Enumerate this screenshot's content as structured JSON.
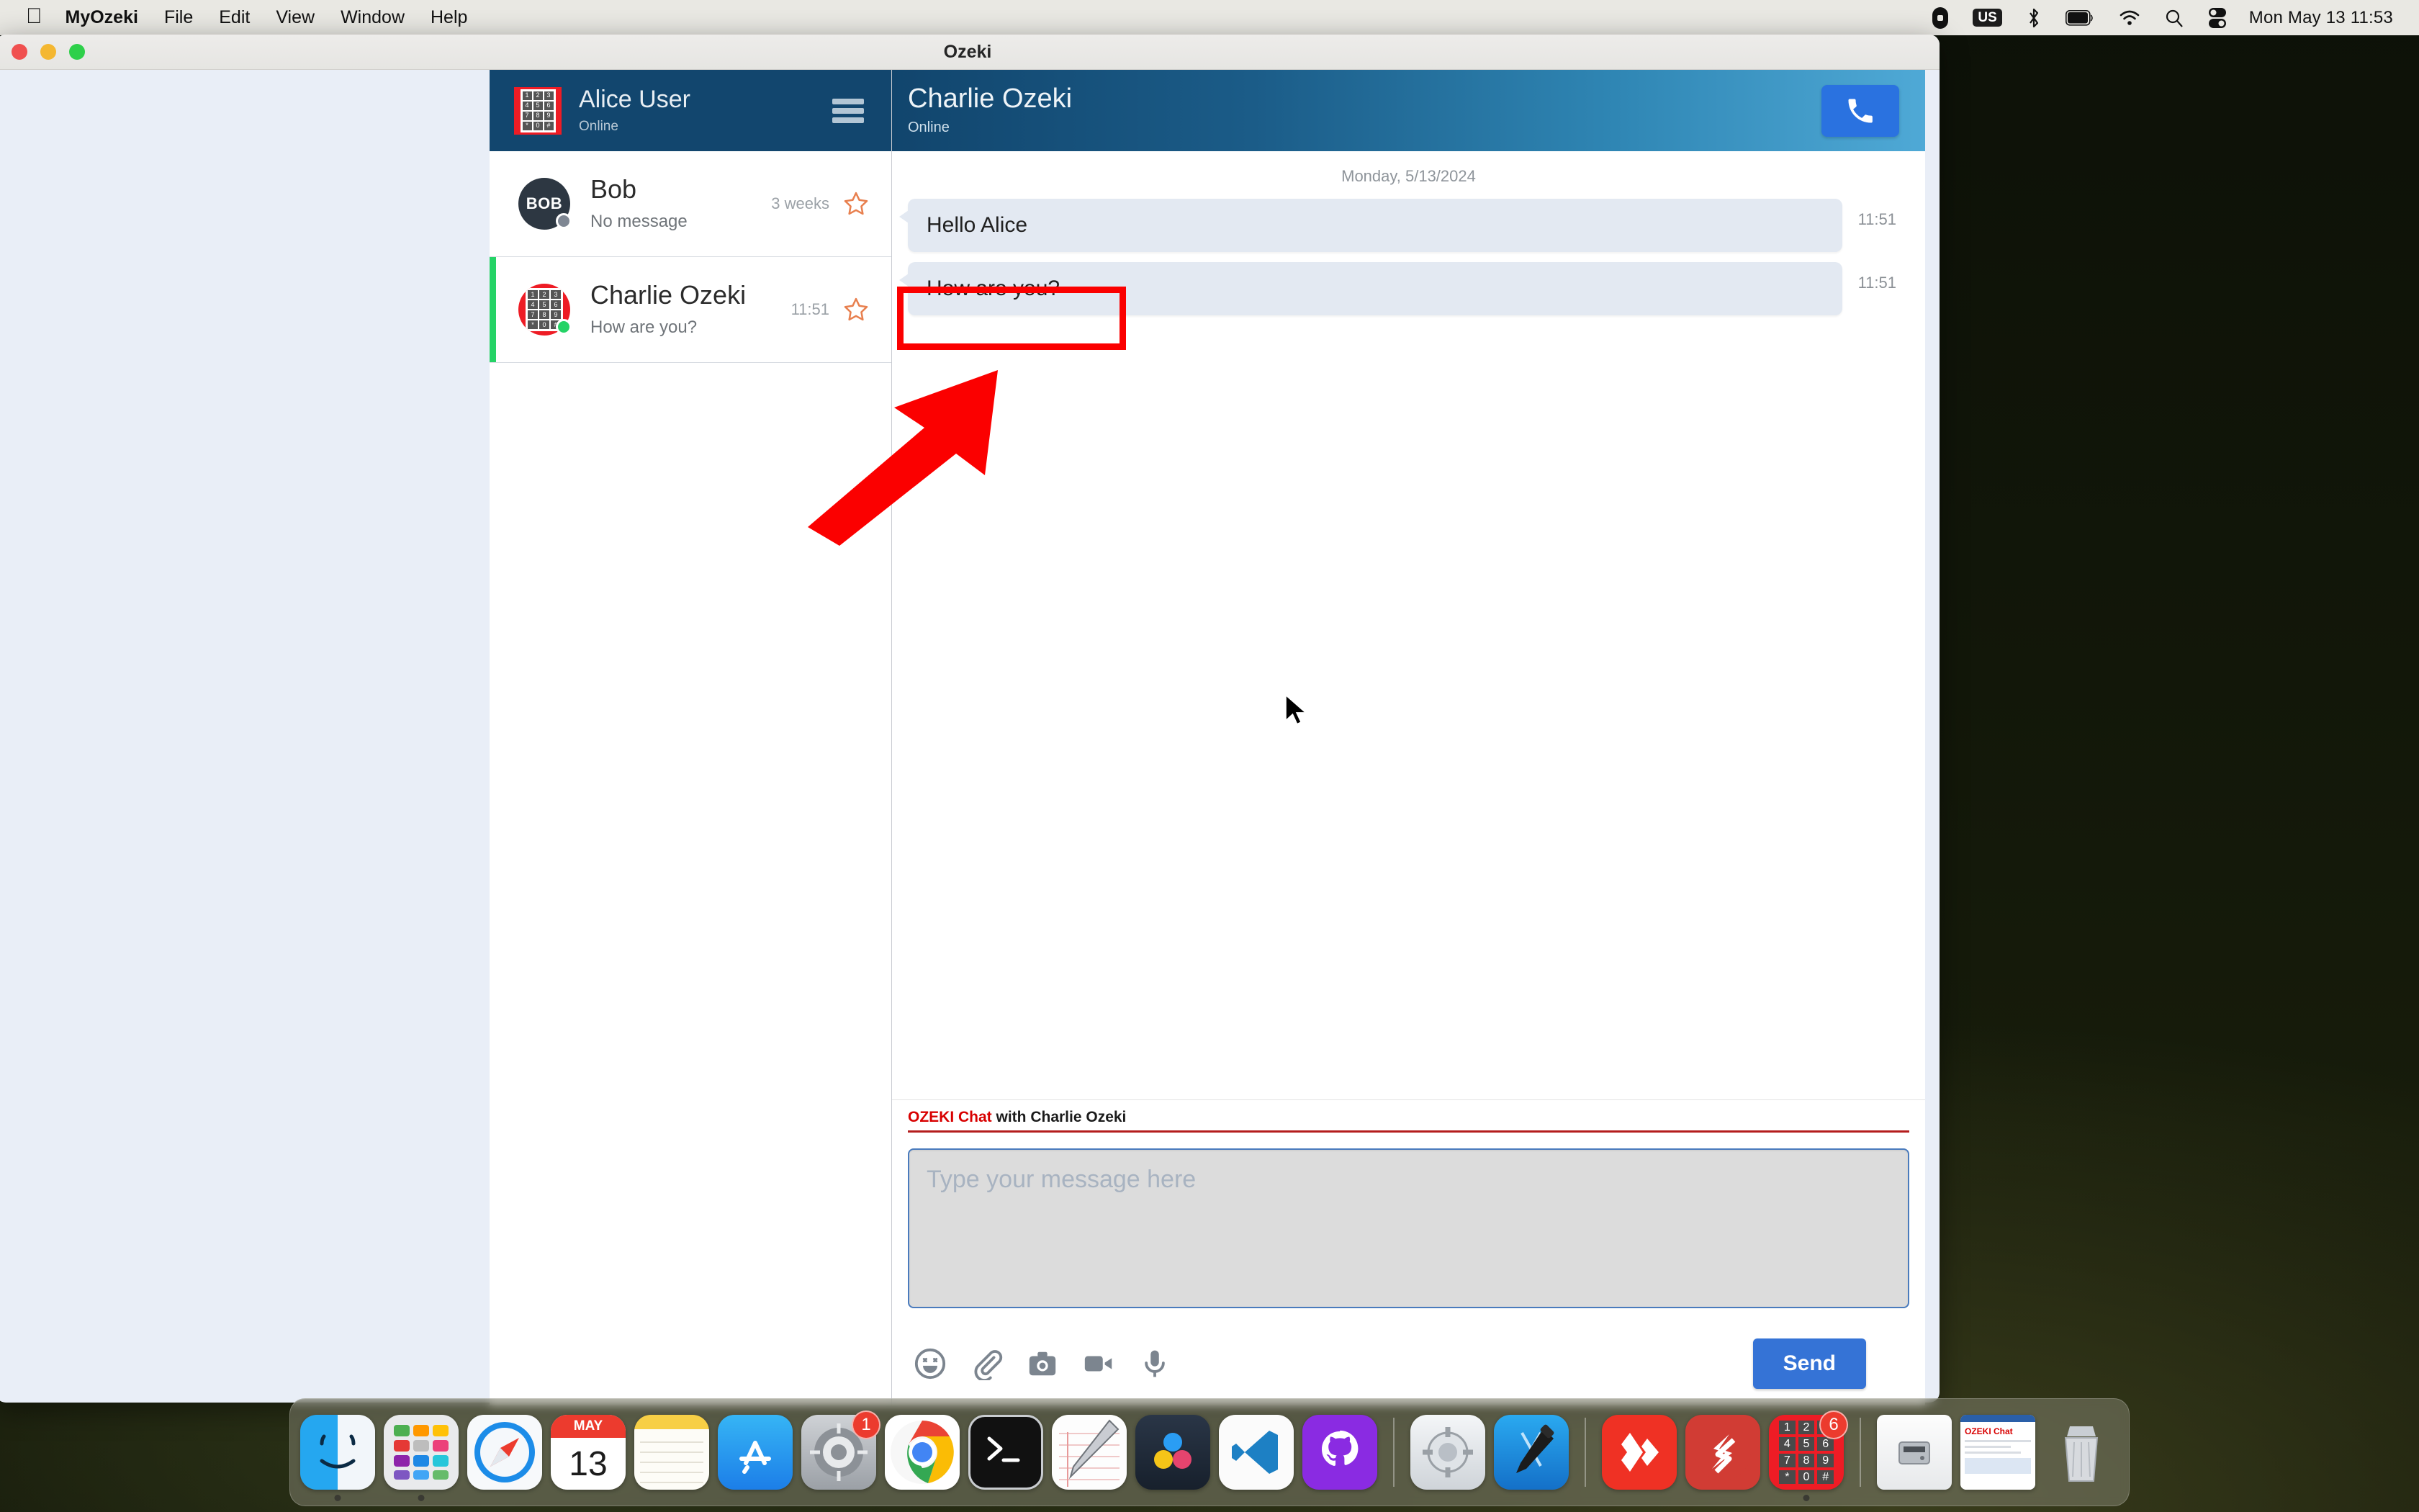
{
  "menubar": {
    "apple_icon": "apple-logo",
    "items": [
      "MyOzeki",
      "File",
      "Edit",
      "View",
      "Window",
      "Help"
    ],
    "right_icons": [
      "control-center-pill-icon",
      "keyboard-layout-icon",
      "bluetooth-icon",
      "battery-icon",
      "wifi-icon",
      "search-icon",
      "control-center-icon"
    ],
    "keyboard_layout": "US",
    "clock": "Mon May 13  11:53"
  },
  "window": {
    "title": "Ozeki",
    "traffic_lights": [
      "close-button",
      "minimize-button",
      "maximize-button"
    ]
  },
  "sidebar": {
    "user": {
      "name": "Alice User",
      "status": "Online",
      "avatar": "ozeki-keypad-logo"
    },
    "menu_icon": "hamburger-menu-icon",
    "contacts": [
      {
        "name": "Bob",
        "preview": "No message",
        "time": "3 weeks",
        "avatar_text": "BOB",
        "presence": "offline",
        "selected": false,
        "starred": false
      },
      {
        "name": "Charlie Ozeki",
        "preview": "How are you?",
        "time": "11:51",
        "avatar_text": "",
        "presence": "online",
        "selected": true,
        "starred": false
      }
    ]
  },
  "chat": {
    "contact_name": "Charlie Ozeki",
    "contact_status": "Online",
    "call_button_icon": "phone-icon",
    "date_separator": "Monday, 5/13/2024",
    "messages": [
      {
        "text": "Hello Alice",
        "time": "11:51",
        "highlighted": false
      },
      {
        "text": "How are you?",
        "time": "11:51",
        "highlighted": true
      }
    ]
  },
  "composer": {
    "label_brand": "OZEKI Chat",
    "label_rest": " with Charlie Ozeki",
    "placeholder": "Type your message here",
    "input_value": "",
    "tools": [
      "emoji-icon",
      "attachment-icon",
      "camera-icon",
      "video-icon",
      "microphone-icon"
    ],
    "send_label": "Send"
  },
  "annotations": {
    "highlight_target": "How are you?",
    "arrow": "red-arrow-pointing-up-right",
    "box_color": "#fb0000"
  },
  "dock": {
    "items": [
      {
        "name": "finder",
        "label": "Finder",
        "running": true
      },
      {
        "name": "launchpad",
        "label": "Launchpad",
        "running": true
      },
      {
        "name": "safari",
        "label": "Safari",
        "running": false
      },
      {
        "name": "calendar",
        "label": "Calendar",
        "month": "MAY",
        "day": "13",
        "running": false
      },
      {
        "name": "notes",
        "label": "Notes",
        "running": false
      },
      {
        "name": "app-store",
        "label": "App Store",
        "running": false
      },
      {
        "name": "system-preferences",
        "label": "System Preferences",
        "badge": "1",
        "running": false
      },
      {
        "name": "chrome",
        "label": "Google Chrome",
        "running": false
      },
      {
        "name": "terminal",
        "label": "Terminal",
        "running": false
      },
      {
        "name": "textedit",
        "label": "TextEdit",
        "running": false
      },
      {
        "name": "davinci-resolve",
        "label": "DaVinci Resolve",
        "running": false
      },
      {
        "name": "visual-studio-code",
        "label": "Visual Studio Code",
        "running": false
      },
      {
        "name": "github-desktop",
        "label": "GitHub Desktop",
        "running": false
      },
      {
        "name": "disk-utility",
        "label": "Disk Utility",
        "running": false
      },
      {
        "name": "xcode",
        "label": "Xcode",
        "running": false
      },
      {
        "name": "anydesk",
        "label": "AnyDesk",
        "running": false
      },
      {
        "name": "ozeki-sip",
        "label": "Ozeki SIP",
        "running": false
      },
      {
        "name": "ozeki-phone",
        "label": "Ozeki Phone",
        "badge": "6",
        "running": true
      },
      {
        "name": "disk-image",
        "label": "Disk Image",
        "running": false
      },
      {
        "name": "ozeki-chat-window",
        "label": "OZEKI Chat",
        "running": false
      },
      {
        "name": "trash",
        "label": "Trash",
        "running": false
      }
    ],
    "ozeki_chat_tile_title": "OZEKI Chat"
  }
}
